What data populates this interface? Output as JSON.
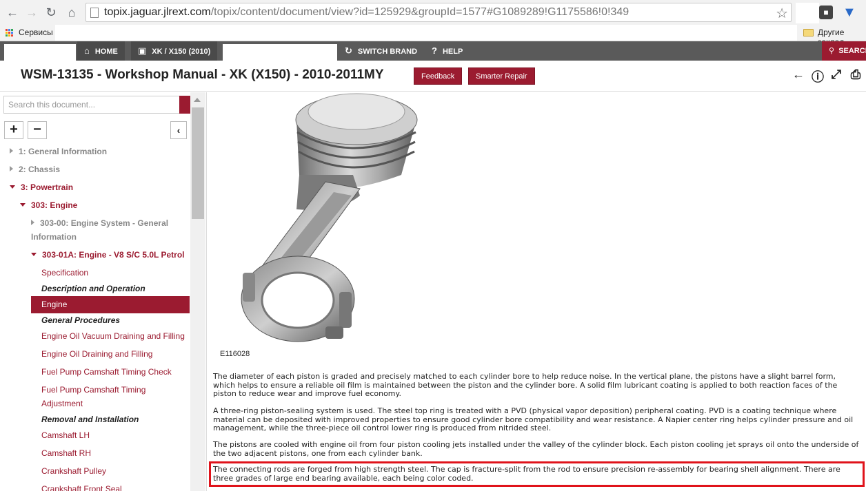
{
  "browser": {
    "url_host": "topix.jaguar.jlrext.com",
    "url_path": "/topix/content/document/view?id=125929&groupId=1577#G1089289!G1175586!0!349",
    "bookmarks_label": "Сервисы",
    "other_bookmarks_label": "Другие заклад"
  },
  "appnav": {
    "home": "HOME",
    "vehicle": "XK / X150 (2010)",
    "switch_brand": "SWITCH BRAND",
    "help": "HELP",
    "search": "SEARCH"
  },
  "header": {
    "title": "WSM-13135 - Workshop Manual - XK (X150) - 2010-2011MY",
    "feedback": "Feedback",
    "smarter_repair": "Smarter Repair"
  },
  "sidebar": {
    "search_placeholder": "Search this document...",
    "tree": {
      "general_info": "1: General Information",
      "chassis": "2: Chassis",
      "powertrain": "3: Powertrain",
      "engine_303": "303: Engine",
      "engine_system": "303-00: Engine System - General Information",
      "engine_v8": "303-01A: Engine - V8 S/C 5.0L Petrol",
      "specification": "Specification",
      "desc_operation": "Description and Operation",
      "engine": "Engine",
      "general_procedures": "General Procedures",
      "oil_vacuum": "Engine Oil Vacuum Draining and Filling",
      "oil_draining": "Engine Oil Draining and Filling",
      "fuel_pump_check": "Fuel Pump Camshaft Timing Check",
      "fuel_pump_adjust": "Fuel Pump Camshaft Timing Adjustment",
      "removal_installation": "Removal and Installation",
      "camshaft_lh": "Camshaft LH",
      "camshaft_rh": "Camshaft RH",
      "crankshaft_pulley": "Crankshaft Pulley",
      "crankshaft_front_seal": "Crankshaft Front Seal"
    }
  },
  "content": {
    "figure_label": "E116028",
    "p1": "The diameter of each piston is graded and precisely matched to each cylinder bore to help reduce noise. In the vertical plane, the pistons have a slight barrel form, which helps to ensure a reliable oil film is maintained between the piston and the cylinder bore. A solid film lubricant coating is applied to both reaction faces of the piston to reduce wear and improve fuel economy.",
    "p2": "A three-ring piston-sealing system is used. The steel top ring is treated with a PVD (physical vapor deposition) peripheral coating. PVD is a coating technique where material can be deposited with improved properties to ensure good cylinder bore compatibility and wear resistance. A Napier center ring helps cylinder pressure and oil management, while the three-piece oil control lower ring is produced from nitrided steel.",
    "p3": "The pistons are cooled with engine oil from four piston cooling jets installed under the valley of the cylinder block. Each piston cooling jet sprays oil onto the underside of the two adjacent pistons, one from each cylinder bank.",
    "p4": "The connecting rods are forged from high strength steel. The cap is fracture-split from the rod to ensure precision re-assembly for bearing shell alignment. There are three grades of large end bearing available, each being color coded."
  },
  "colors": {
    "brand": "#9b1b30",
    "nav_bar": "#5a5a5a",
    "highlight_border": "#e0131b"
  }
}
